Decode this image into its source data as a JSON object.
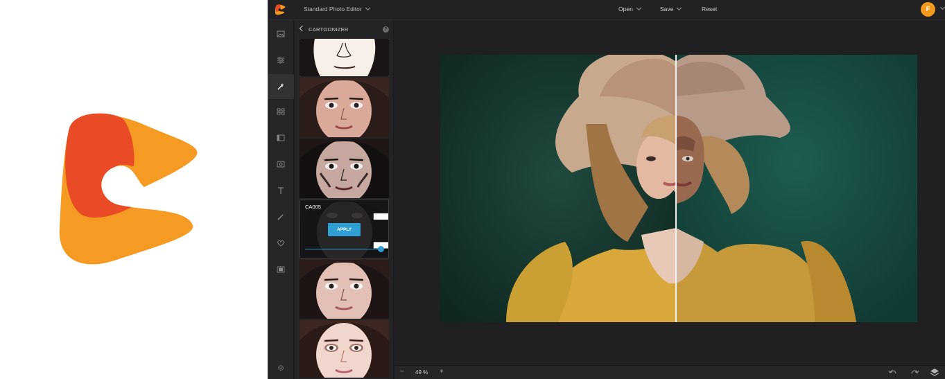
{
  "app": {
    "title": "Standard Photo Editor",
    "accent_color": "#2f9ed3",
    "brand_color": "#f39a1e"
  },
  "topbar": {
    "open_label": "Open",
    "save_label": "Save",
    "reset_label": "Reset",
    "avatar_initial": "F"
  },
  "rail": {
    "items": [
      "image-icon",
      "adjust-icon",
      "magic-wand-icon",
      "grid-icon",
      "frame-icon",
      "photo-filter-icon",
      "text-icon",
      "brush-icon",
      "heart-icon",
      "film-icon",
      "settings-icon"
    ],
    "active_item": "magic-wand-icon"
  },
  "panel": {
    "title": "CARTOONIZER",
    "help_label": "?",
    "active_effect": {
      "name": "CA005",
      "apply_label": "APPLY",
      "intensity_percent": 100
    }
  },
  "bottombar": {
    "zoom_minus": "−",
    "zoom_level": "49 %",
    "zoom_plus": "+"
  }
}
